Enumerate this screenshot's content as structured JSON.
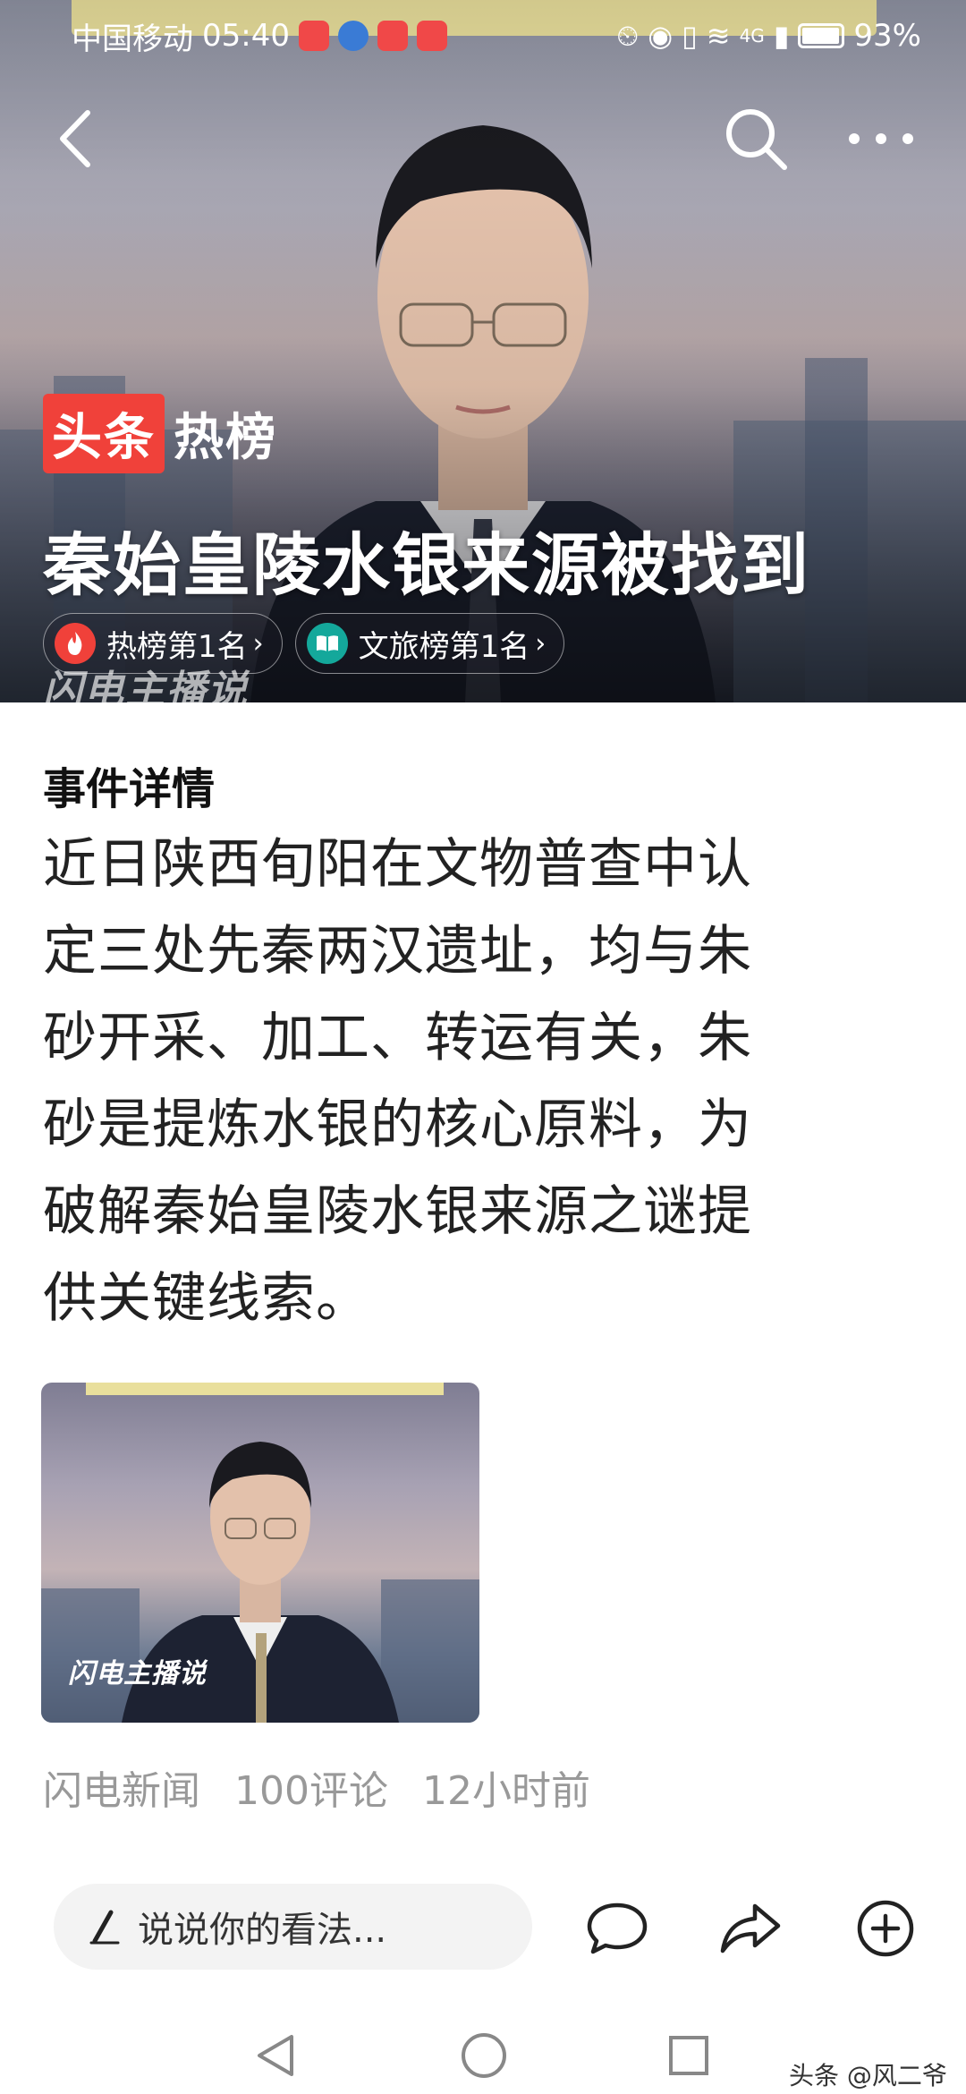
{
  "status_bar": {
    "carrier": "中国移动",
    "time": "05:40",
    "network": "4G",
    "battery_percent": "93%",
    "battery_level": 0.93,
    "app_icon_colors": [
      "#f04848",
      "#3a7bd5",
      "#f04848",
      "#f04848"
    ]
  },
  "top_nav": {
    "back_icon": "chevron-left-icon",
    "search_icon": "search-icon",
    "more_icon": "more-dots-icon"
  },
  "hero": {
    "brand_box": "头条",
    "brand_text": "热榜",
    "title": "秦始皇陵水银来源被找到",
    "chips": [
      {
        "label": "热榜第1名",
        "arrow": "›",
        "icon": "flame-icon",
        "icon_color": "#f0413a"
      },
      {
        "label": "文旅榜第1名",
        "arrow": "›",
        "icon": "book-icon",
        "icon_color": "#14a89b"
      }
    ],
    "watermark": "闪电主播说"
  },
  "content": {
    "section_title": "事件详情",
    "detail_lines": [
      "近日陕西旬阳在文物普查中认",
      "定三处先秦两汉遗址，均与朱",
      "砂开采、加工、转运有关，朱",
      "砂是提炼水银的核心原料，为",
      "破解秦始皇陵水银来源之谜提",
      "供关键线索。"
    ],
    "thumb_watermark": "闪电主播说",
    "meta": {
      "source": "闪电新闻",
      "comments": "100评论",
      "time": "12小时前"
    }
  },
  "bottom_bar": {
    "comment_placeholder": "说说你的看法...",
    "pen_icon": "pen-icon",
    "actions": [
      "comment-icon",
      "share-icon",
      "add-icon"
    ]
  },
  "footer": {
    "watermark": "头条 @风二爷"
  },
  "colors": {
    "brand_red": "#f0413a",
    "meta_gray": "#999999",
    "text_dark": "#222222"
  }
}
